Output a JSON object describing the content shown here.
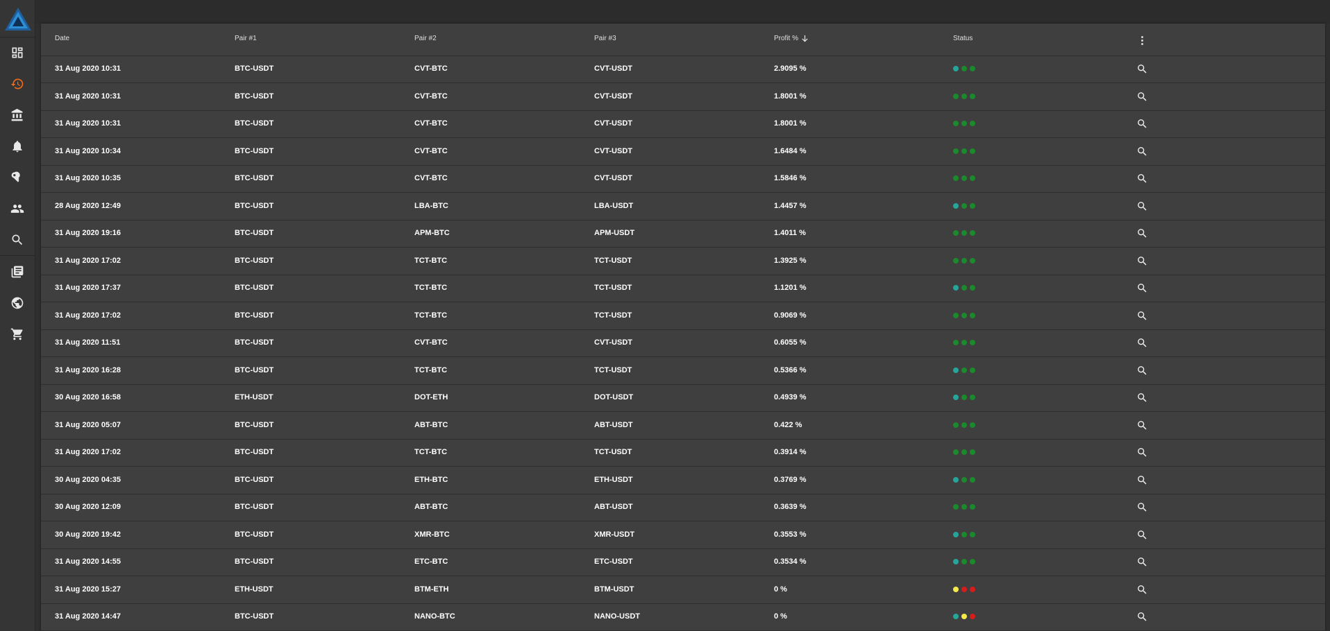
{
  "colors": {
    "teal": "#26a69a",
    "green": "#1b8a2c",
    "yellow": "#f6e94a",
    "red": "#d81b1b",
    "accent": "#ef6c1a"
  },
  "sidebar": {
    "logo": "triangle-logo",
    "items": [
      {
        "icon": "dashboard-icon"
      },
      {
        "icon": "history-icon",
        "active": true
      },
      {
        "icon": "bank-icon"
      },
      {
        "icon": "bell-icon"
      },
      {
        "icon": "key-icon"
      },
      {
        "icon": "users-icon"
      },
      {
        "icon": "search-icon"
      },
      {
        "icon": "library-icon"
      },
      {
        "icon": "globe-icon"
      },
      {
        "icon": "cart-icon"
      }
    ]
  },
  "table": {
    "headers": {
      "date": "Date",
      "pair1": "Pair #1",
      "pair2": "Pair #2",
      "pair3": "Pair #3",
      "profit": "Profit %",
      "status": "Status"
    },
    "sort": "profit-descending",
    "rows": [
      {
        "date": "31 Aug 2020 10:31",
        "pair1": "BTC-USDT",
        "pair2": "CVT-BTC",
        "pair3": "CVT-USDT",
        "profit": "2.9095 %",
        "status": [
          "teal",
          "green",
          "green"
        ]
      },
      {
        "date": "31 Aug 2020 10:31",
        "pair1": "BTC-USDT",
        "pair2": "CVT-BTC",
        "pair3": "CVT-USDT",
        "profit": "1.8001 %",
        "status": [
          "green",
          "green",
          "green"
        ]
      },
      {
        "date": "31 Aug 2020 10:31",
        "pair1": "BTC-USDT",
        "pair2": "CVT-BTC",
        "pair3": "CVT-USDT",
        "profit": "1.8001 %",
        "status": [
          "green",
          "green",
          "green"
        ]
      },
      {
        "date": "31 Aug 2020 10:34",
        "pair1": "BTC-USDT",
        "pair2": "CVT-BTC",
        "pair3": "CVT-USDT",
        "profit": "1.6484 %",
        "status": [
          "green",
          "green",
          "green"
        ]
      },
      {
        "date": "31 Aug 2020 10:35",
        "pair1": "BTC-USDT",
        "pair2": "CVT-BTC",
        "pair3": "CVT-USDT",
        "profit": "1.5846 %",
        "status": [
          "green",
          "green",
          "green"
        ]
      },
      {
        "date": "28 Aug 2020 12:49",
        "pair1": "BTC-USDT",
        "pair2": "LBA-BTC",
        "pair3": "LBA-USDT",
        "profit": "1.4457 %",
        "status": [
          "teal",
          "green",
          "green"
        ]
      },
      {
        "date": "31 Aug 2020 19:16",
        "pair1": "BTC-USDT",
        "pair2": "APM-BTC",
        "pair3": "APM-USDT",
        "profit": "1.4011 %",
        "status": [
          "green",
          "green",
          "green"
        ]
      },
      {
        "date": "31 Aug 2020 17:02",
        "pair1": "BTC-USDT",
        "pair2": "TCT-BTC",
        "pair3": "TCT-USDT",
        "profit": "1.3925 %",
        "status": [
          "green",
          "green",
          "green"
        ]
      },
      {
        "date": "31 Aug 2020 17:37",
        "pair1": "BTC-USDT",
        "pair2": "TCT-BTC",
        "pair3": "TCT-USDT",
        "profit": "1.1201 %",
        "status": [
          "teal",
          "green",
          "green"
        ]
      },
      {
        "date": "31 Aug 2020 17:02",
        "pair1": "BTC-USDT",
        "pair2": "TCT-BTC",
        "pair3": "TCT-USDT",
        "profit": "0.9069 %",
        "status": [
          "green",
          "green",
          "green"
        ]
      },
      {
        "date": "31 Aug 2020 11:51",
        "pair1": "BTC-USDT",
        "pair2": "CVT-BTC",
        "pair3": "CVT-USDT",
        "profit": "0.6055 %",
        "status": [
          "green",
          "green",
          "green"
        ]
      },
      {
        "date": "31 Aug 2020 16:28",
        "pair1": "BTC-USDT",
        "pair2": "TCT-BTC",
        "pair3": "TCT-USDT",
        "profit": "0.5366 %",
        "status": [
          "teal",
          "green",
          "green"
        ]
      },
      {
        "date": "30 Aug 2020 16:58",
        "pair1": "ETH-USDT",
        "pair2": "DOT-ETH",
        "pair3": "DOT-USDT",
        "profit": "0.4939 %",
        "status": [
          "teal",
          "green",
          "green"
        ]
      },
      {
        "date": "31 Aug 2020 05:07",
        "pair1": "BTC-USDT",
        "pair2": "ABT-BTC",
        "pair3": "ABT-USDT",
        "profit": "0.422 %",
        "status": [
          "green",
          "green",
          "green"
        ]
      },
      {
        "date": "31 Aug 2020 17:02",
        "pair1": "BTC-USDT",
        "pair2": "TCT-BTC",
        "pair3": "TCT-USDT",
        "profit": "0.3914 %",
        "status": [
          "green",
          "green",
          "green"
        ]
      },
      {
        "date": "30 Aug 2020 04:35",
        "pair1": "BTC-USDT",
        "pair2": "ETH-BTC",
        "pair3": "ETH-USDT",
        "profit": "0.3769 %",
        "status": [
          "teal",
          "green",
          "green"
        ]
      },
      {
        "date": "30 Aug 2020 12:09",
        "pair1": "BTC-USDT",
        "pair2": "ABT-BTC",
        "pair3": "ABT-USDT",
        "profit": "0.3639 %",
        "status": [
          "green",
          "green",
          "green"
        ]
      },
      {
        "date": "30 Aug 2020 19:42",
        "pair1": "BTC-USDT",
        "pair2": "XMR-BTC",
        "pair3": "XMR-USDT",
        "profit": "0.3553 %",
        "status": [
          "teal",
          "green",
          "green"
        ]
      },
      {
        "date": "31 Aug 2020 14:55",
        "pair1": "BTC-USDT",
        "pair2": "ETC-BTC",
        "pair3": "ETC-USDT",
        "profit": "0.3534 %",
        "status": [
          "teal",
          "green",
          "green"
        ]
      },
      {
        "date": "31 Aug 2020 15:27",
        "pair1": "ETH-USDT",
        "pair2": "BTM-ETH",
        "pair3": "BTM-USDT",
        "profit": "0 %",
        "status": [
          "yellow",
          "red",
          "red"
        ]
      },
      {
        "date": "31 Aug 2020 14:47",
        "pair1": "BTC-USDT",
        "pair2": "NANO-BTC",
        "pair3": "NANO-USDT",
        "profit": "0 %",
        "status": [
          "teal",
          "yellow",
          "red"
        ]
      }
    ]
  }
}
